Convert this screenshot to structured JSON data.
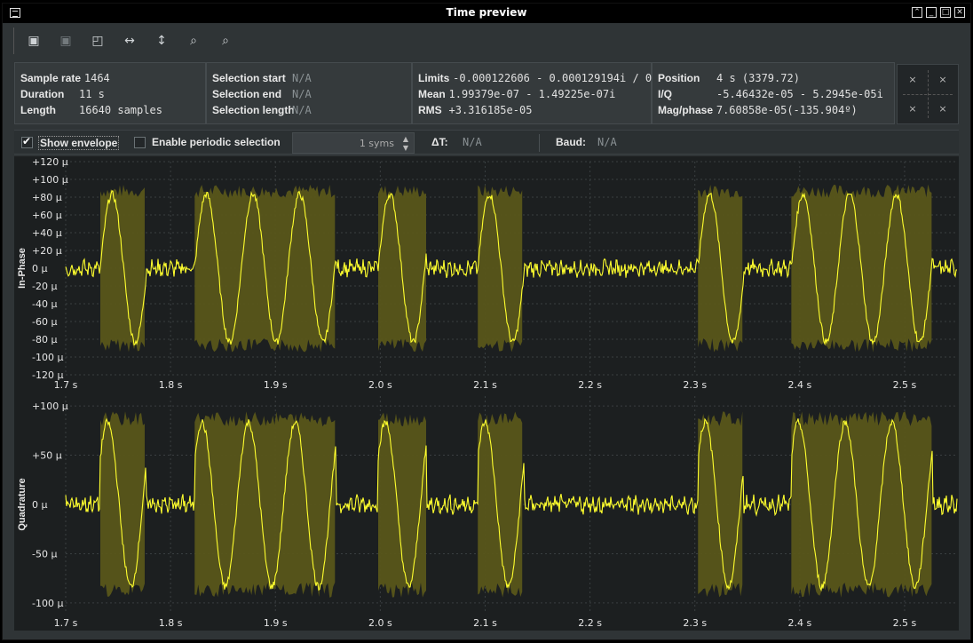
{
  "window": {
    "title": "Time preview"
  },
  "toolbar": {
    "icons": [
      "open-icon",
      "save-icon",
      "delete-icon",
      "fit-horizontal-icon",
      "fit-vertical-icon",
      "zoom-out-icon",
      "zoom-in-icon"
    ]
  },
  "info": {
    "sample_rate_label": "Sample rate",
    "sample_rate_value": "1464",
    "duration_label": "Duration",
    "duration_value": "11 s",
    "length_label": "Length",
    "length_value": "16640 samples",
    "selection_start_label": "Selection start",
    "selection_start_value": "N/A",
    "selection_end_label": "Selection end",
    "selection_end_value": "N/A",
    "selection_length_label": "Selection length",
    "selection_length_value": "N/A",
    "limits_label": "Limits",
    "limits_value": "-0.000122606 - 0.000129194i / 0",
    "mean_label": "Mean",
    "mean_value": "1.99379e-07 - 1.49225e-07i",
    "rms_label": "RMS",
    "rms_value": "+3.316185e-05",
    "position_label": "Position",
    "position_value": "4 s (3379.72)",
    "iq_label": "I/Q",
    "iq_value": "-5.46432e-05 - 5.2945e-05i",
    "magphase_label": "Mag/phase",
    "magphase_value": "7.60858e-05(-135.904º)"
  },
  "options": {
    "show_envelope_label": "Show envelope",
    "show_envelope_checked": true,
    "periodic_selection_label": "Enable periodic selection",
    "periodic_selection_checked": false,
    "syms_value": "1 syms",
    "delta_t_label": "ΔT:",
    "delta_t_value": "N/A",
    "baud_label": "Baud:",
    "baud_value": "N/A"
  },
  "colors": {
    "trace": "#ffff2e",
    "envelope": "#59561a",
    "plot_bg": "#1c1f20",
    "grid": "#3a3f41"
  },
  "chart_data": [
    {
      "type": "line",
      "ylabel": "In-Phase",
      "x_ticks": [
        "1.7 s",
        "1.8 s",
        "1.9 s",
        "2.0 s",
        "2.1 s",
        "2.2 s",
        "2.3 s",
        "2.4 s",
        "2.5 s"
      ],
      "y_ticks": [
        "+120 µ",
        "+100 µ",
        "+80 µ",
        "+60 µ",
        "+40 µ",
        "+20 µ",
        "0 µ",
        "-20 µ",
        "-40 µ",
        "-60 µ",
        "-80 µ",
        "-100 µ",
        "-120 µ"
      ],
      "xlim": [
        1.7,
        2.55
      ],
      "ylim": [
        -120,
        120
      ],
      "grid": true,
      "bursts_s": [
        [
          1.733,
          1.777
        ],
        [
          1.823,
          1.958
        ],
        [
          1.998,
          2.044
        ],
        [
          2.093,
          2.137
        ],
        [
          2.303,
          2.346
        ],
        [
          2.392,
          2.527
        ]
      ],
      "envelope_amplitude_u": 86
    },
    {
      "type": "line",
      "ylabel": "Quadrature",
      "x_ticks": [
        "1.7 s",
        "1.8 s",
        "1.9 s",
        "2.0 s",
        "2.1 s",
        "2.2 s",
        "2.3 s",
        "2.4 s",
        "2.5 s"
      ],
      "y_ticks": [
        "+100 µ",
        "+50 µ",
        "0 µ",
        "-50 µ",
        "-100 µ"
      ],
      "xlim": [
        1.7,
        2.55
      ],
      "ylim": [
        -110,
        110
      ],
      "grid": true,
      "bursts_s": [
        [
          1.733,
          1.777
        ],
        [
          1.823,
          1.958
        ],
        [
          1.998,
          2.044
        ],
        [
          2.093,
          2.137
        ],
        [
          2.303,
          2.346
        ],
        [
          2.392,
          2.527
        ]
      ],
      "envelope_amplitude_u": 86
    }
  ]
}
